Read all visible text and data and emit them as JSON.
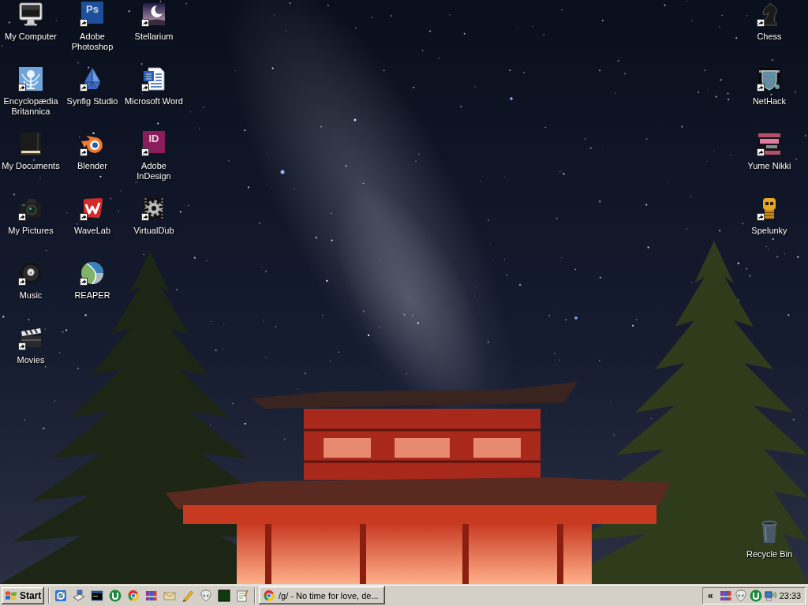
{
  "desktop": {
    "left_columns": [
      {
        "icons": [
          {
            "label": "My Computer",
            "kind": "computer",
            "shortcut": false
          },
          {
            "label": "Encyclopædia Britannica",
            "kind": "thistle",
            "shortcut": true
          },
          {
            "label": "My Documents",
            "kind": "notebook",
            "shortcut": false
          },
          {
            "label": "My Pictures",
            "kind": "camera",
            "shortcut": true
          },
          {
            "label": "Music",
            "kind": "disc",
            "shortcut": true
          },
          {
            "label": "Movies",
            "kind": "clapper",
            "shortcut": true
          }
        ]
      },
      {
        "icons": [
          {
            "label": "Adobe Photoshop",
            "kind": "tile",
            "tile_text": "Ps",
            "color": "#1d4f9a",
            "shortcut": true
          },
          {
            "label": "Synfig Studio",
            "kind": "crystal",
            "shortcut": true
          },
          {
            "label": "Blender",
            "kind": "blender",
            "shortcut": true
          },
          {
            "label": "WaveLab",
            "kind": "wave",
            "shortcut": true
          },
          {
            "label": "REAPER",
            "kind": "swirl",
            "shortcut": true
          }
        ]
      },
      {
        "icons": [
          {
            "label": "Stellarium",
            "kind": "moon",
            "shortcut": true
          },
          {
            "label": "Microsoft Word",
            "kind": "document",
            "shortcut": true
          },
          {
            "label": "Adobe InDesign",
            "kind": "tile",
            "tile_text": "ID",
            "color": "#8a1e5c",
            "shortcut": true
          },
          {
            "label": "VirtualDub",
            "kind": "gear",
            "shortcut": true
          }
        ]
      }
    ],
    "right_icons": [
      {
        "label": "Chess",
        "kind": "knight",
        "shortcut": true
      },
      {
        "label": "NetHack",
        "kind": "shield",
        "shortcut": true
      },
      {
        "label": "Yume Nikki",
        "kind": "pixelsign",
        "shortcut": true
      },
      {
        "label": "Spelunky",
        "kind": "skull",
        "shortcut": true
      }
    ],
    "recycle_bin": {
      "label": "Recycle Bin",
      "kind": "trash"
    }
  },
  "taskbar": {
    "start_button": {
      "label": "Start"
    },
    "quick_launch": [
      {
        "kind": "swirlpage"
      },
      {
        "kind": "desk"
      },
      {
        "kind": "console"
      },
      {
        "kind": "ulogo"
      },
      {
        "kind": "ball"
      },
      {
        "kind": "books"
      },
      {
        "kind": "envelope"
      },
      {
        "kind": "pencil"
      },
      {
        "kind": "alien"
      },
      {
        "kind": "tile"
      },
      {
        "kind": "notepad"
      }
    ],
    "tasks": [
      {
        "label": "/g/ - No time for love, de...",
        "kind": "ball",
        "selected": false
      }
    ],
    "tray": {
      "expand_button": "«",
      "icons": [
        {
          "kind": "books"
        },
        {
          "kind": "alien"
        },
        {
          "kind": "ulogo"
        },
        {
          "kind": "network"
        }
      ],
      "clock": "23:33"
    }
  }
}
